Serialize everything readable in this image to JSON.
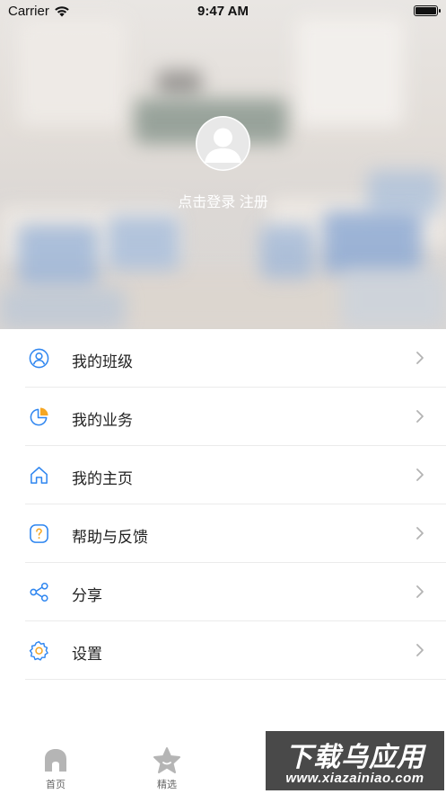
{
  "status_bar": {
    "carrier": "Carrier",
    "time": "9:47 AM"
  },
  "profile": {
    "login_text": "点击登录",
    "register_text": "注册"
  },
  "menu": {
    "items": [
      {
        "label": "我的班级",
        "icon": "user-circle-icon"
      },
      {
        "label": "我的业务",
        "icon": "pie-chart-icon"
      },
      {
        "label": "我的主页",
        "icon": "home-icon"
      },
      {
        "label": "帮助与反馈",
        "icon": "help-icon"
      },
      {
        "label": "分享",
        "icon": "share-icon"
      },
      {
        "label": "设置",
        "icon": "settings-gear-icon"
      }
    ]
  },
  "tabbar": {
    "tabs": [
      {
        "label": "首页",
        "icon": "home-tab-icon"
      },
      {
        "label": "精选",
        "icon": "star-tab-icon"
      }
    ]
  },
  "watermark": {
    "title": "下载乌应用",
    "url": "www.xiazainiao.com"
  },
  "colors": {
    "accent_blue": "#2f86f0",
    "accent_orange": "#f5a623",
    "text": "#222222",
    "chevron": "#b3b3b3"
  }
}
